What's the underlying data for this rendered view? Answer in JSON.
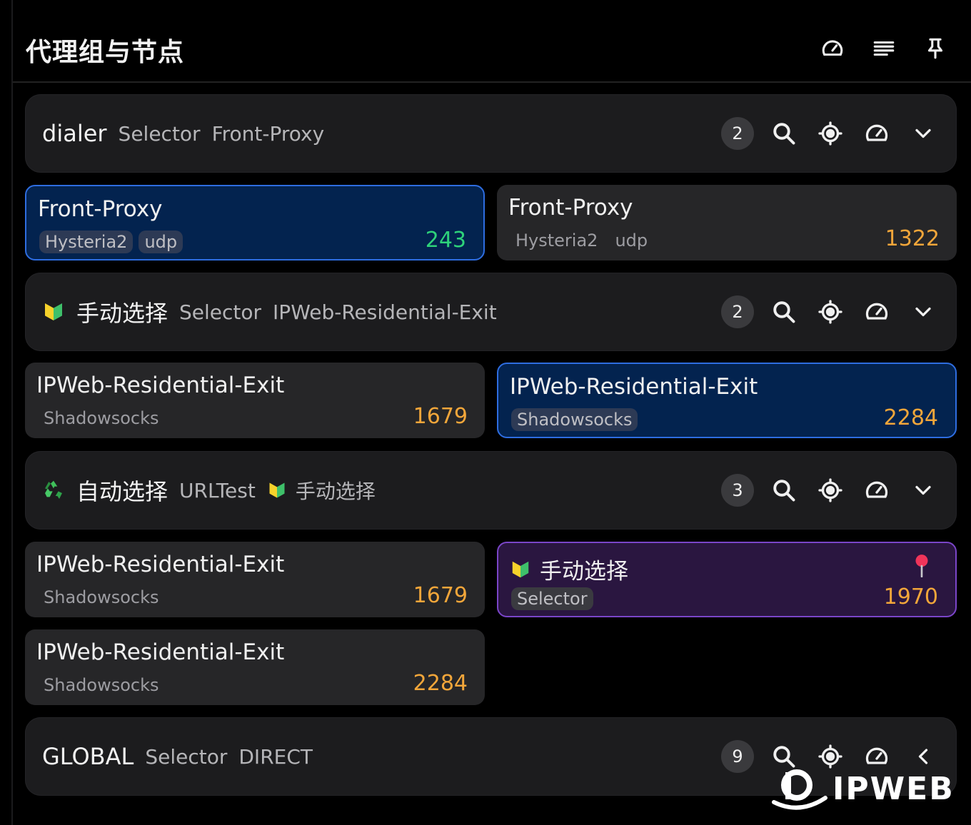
{
  "header": {
    "title": "代理组与节点"
  },
  "groups": [
    {
      "name": "dialer",
      "type": "Selector",
      "now": "Front-Proxy",
      "count": "2"
    },
    {
      "emoji": "🔰",
      "name": "手动选择",
      "type": "Selector",
      "now": "IPWeb-Residential-Exit",
      "count": "2"
    },
    {
      "emoji": "♻️",
      "name": "自动选择",
      "type": "URLTest",
      "now_emoji": "🔰",
      "now": "手动选择",
      "count": "3"
    },
    {
      "name": "GLOBAL",
      "type": "Selector",
      "now": "DIRECT",
      "count": "9"
    }
  ],
  "cards": [
    {
      "name": "Front-Proxy",
      "tags": [
        "Hysteria2",
        "udp"
      ],
      "delay": "243",
      "state": "active"
    },
    {
      "name": "Front-Proxy",
      "tags": [
        "Hysteria2",
        "udp"
      ],
      "delay": "1322"
    },
    {
      "name": "IPWeb-Residential-Exit",
      "tags": [
        "Shadowsocks"
      ],
      "delay": "1679"
    },
    {
      "name": "IPWeb-Residential-Exit",
      "tags": [
        "Shadowsocks"
      ],
      "delay": "2284",
      "state": "active"
    },
    {
      "name": "IPWeb-Residential-Exit",
      "tags": [
        "Shadowsocks"
      ],
      "delay": "1679"
    },
    {
      "emoji": "🔰",
      "name": "手动选择",
      "tags": [
        "Selector"
      ],
      "delay": "1970",
      "state": "selected-pinned"
    },
    {
      "name": "IPWeb-Residential-Exit",
      "tags": [
        "Shadowsocks"
      ],
      "delay": "2284"
    }
  ],
  "watermark": {
    "text": "IPWEB"
  },
  "colors": {
    "active_border": "#2e6de0",
    "pinned_border": "#7a45c8",
    "delay_good": "#2ed27a",
    "delay_warn": "#f2a63a"
  }
}
